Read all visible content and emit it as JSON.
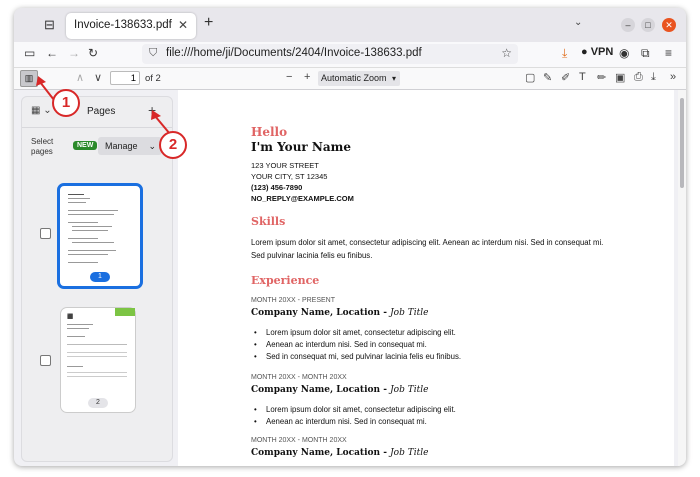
{
  "tab": {
    "title": "Invoice-138633.pdf"
  },
  "navbar": {
    "url": "file:///home/ji/Documents/2404/Invoice-138633.pdf",
    "vpn_label": "VPN"
  },
  "pdfbar": {
    "page_value": "1",
    "page_count": "of 2",
    "zoom": "Automatic Zoom"
  },
  "sidebar": {
    "title": "Pages",
    "select_label": "Select pages",
    "new_badge": "NEW",
    "manage_label": "Manage",
    "thumbnails": [
      {
        "page": "1",
        "selected": true
      },
      {
        "page": "2",
        "selected": false
      }
    ]
  },
  "annotations": [
    "1",
    "2"
  ],
  "document": {
    "hello": "Hello",
    "name": "I'm Your Name",
    "address": [
      "123 YOUR STREET",
      "YOUR CITY, ST 12345",
      "(123) 456-7890",
      "NO_REPLY@EXAMPLE.COM"
    ],
    "skills_title": "Skills",
    "skills_text": "Lorem ipsum dolor sit amet, consectetur adipiscing elit. Aenean ac interdum nisi. Sed in consequat mi. Sed pulvinar lacinia felis eu finibus.",
    "experience_title": "Experience",
    "jobs": [
      {
        "dates": "MONTH 20XX - PRESENT",
        "company": "Company Name, Location - ",
        "title": "Job Title",
        "bullets": [
          "Lorem ipsum dolor sit amet, consectetur adipiscing elit.",
          "Aenean ac interdum nisi. Sed in consequat mi.",
          "Sed in consequat mi, sed pulvinar lacinia felis eu finibus."
        ]
      },
      {
        "dates": "MONTH 20XX - MONTH 20XX",
        "company": "Company Name, Location - ",
        "title": "Job Title",
        "bullets": [
          "Lorem ipsum dolor sit amet, consectetur adipiscing elit.",
          "Aenean ac interdum nisi. Sed in consequat mi."
        ]
      },
      {
        "dates": "MONTH 20XX - MONTH 20XX",
        "company": "Company Name, Location - ",
        "title": "Job Title",
        "bullets": []
      }
    ]
  },
  "colors": {
    "accent": "#e06464",
    "selection": "#1a6fe0",
    "annotation": "#d82828"
  }
}
